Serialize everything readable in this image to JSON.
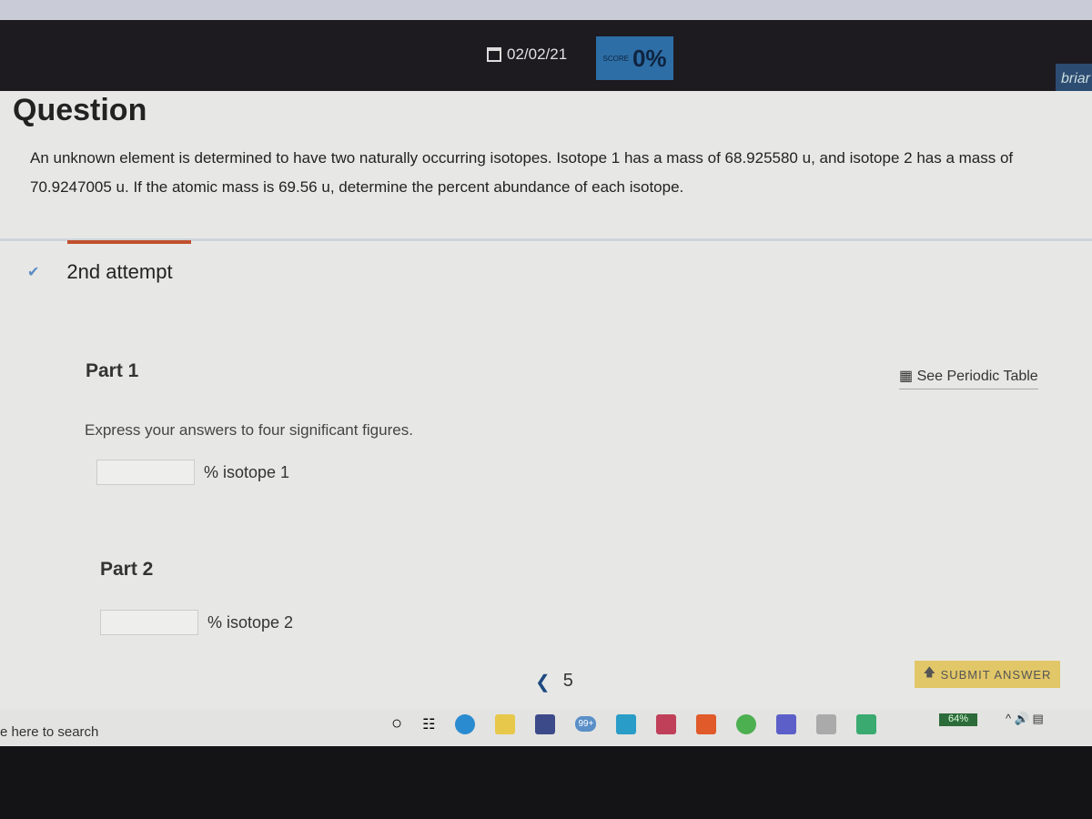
{
  "header": {
    "date": "02/02/21",
    "score_label": "SCORE",
    "score_value": "0%",
    "user": "briar"
  },
  "question": {
    "title": "Question",
    "text": "An unknown element is determined to have two naturally occurring isotopes. Isotope 1 has a mass of 68.925580 u, and isotope 2 has a mass of 70.9247005 u. If the atomic mass is 69.56 u, determine the percent abundance of each isotope."
  },
  "attempt": {
    "label": "2nd attempt"
  },
  "part1": {
    "label": "Part 1",
    "instructions": "Express your answers to four significant figures.",
    "field_label": "% isotope 1",
    "value": ""
  },
  "part2": {
    "label": "Part 2",
    "field_label": "% isotope 2",
    "value": ""
  },
  "periodic_table": "See Periodic Table",
  "pager": {
    "current": "5"
  },
  "submit_label": "SUBMIT ANSWER",
  "taskbar": {
    "search_placeholder": "e here to search",
    "mail_badge": "99+",
    "battery": "64%"
  },
  "colors": {
    "accent_tab": "#c0502e",
    "score_bg": "#2d6ea6",
    "submit_bg": "#e2c768"
  }
}
